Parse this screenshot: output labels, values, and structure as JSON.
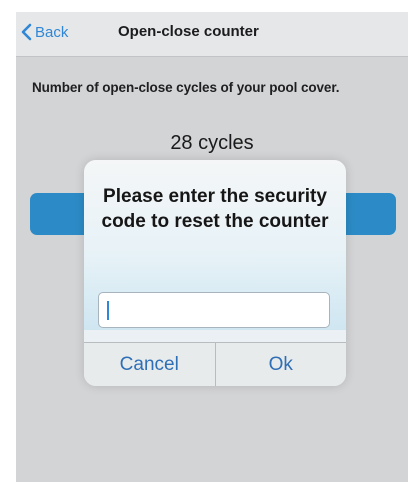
{
  "navbar": {
    "back_label": "Back",
    "title": "Open-close counter"
  },
  "content": {
    "description": "Number of open-close cycles of your pool cover.",
    "cycles_text": "28 cycles"
  },
  "dialog": {
    "message": "Please enter the security code to reset the counter",
    "input_value": "",
    "cancel_label": "Cancel",
    "ok_label": "Ok"
  },
  "colors": {
    "accent": "#2f87d5",
    "reset_button": "#2c8bc6",
    "background": "#d3d4d6"
  },
  "icons": {
    "back": "chevron-left-icon"
  }
}
